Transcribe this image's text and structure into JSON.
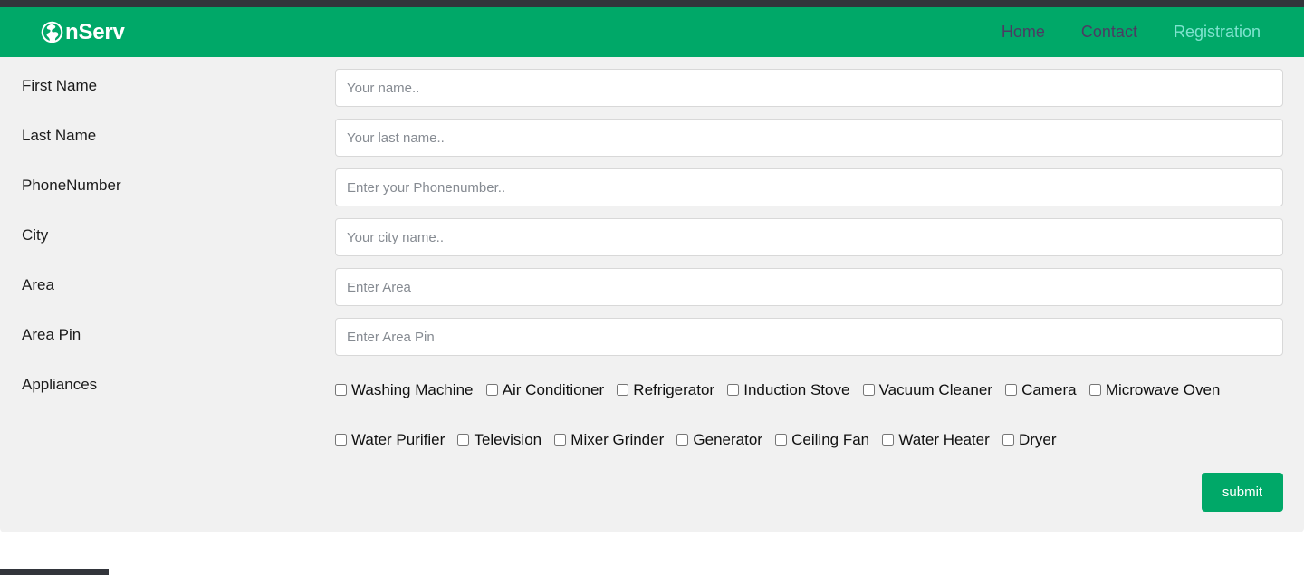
{
  "header": {
    "brand_name": "nServ",
    "brand_icon": "globe-icon",
    "background_color": "#00a868",
    "nav_links": [
      {
        "label": "Home",
        "state": "visited"
      },
      {
        "label": "Contact",
        "state": "visited"
      },
      {
        "label": "Registration",
        "state": "active"
      }
    ]
  },
  "form": {
    "fields": [
      {
        "label": "First Name",
        "placeholder": "Your name..",
        "value": ""
      },
      {
        "label": "Last Name",
        "placeholder": "Your last name..",
        "value": ""
      },
      {
        "label": "PhoneNumber",
        "placeholder": "Enter your Phonenumber..",
        "value": ""
      },
      {
        "label": "City",
        "placeholder": "Your city name..",
        "value": ""
      },
      {
        "label": "Area",
        "placeholder": "Enter Area",
        "value": ""
      },
      {
        "label": "Area Pin",
        "placeholder": "Enter Area Pin",
        "value": ""
      }
    ],
    "appliances_label": "Appliances",
    "appliances": [
      {
        "label": "Washing Machine",
        "checked": false
      },
      {
        "label": "Air Conditioner",
        "checked": false
      },
      {
        "label": "Refrigerator",
        "checked": false
      },
      {
        "label": "Induction Stove",
        "checked": false
      },
      {
        "label": "Vacuum Cleaner",
        "checked": false
      },
      {
        "label": "Camera",
        "checked": false
      },
      {
        "label": "Microwave Oven",
        "checked": false
      },
      {
        "label": "Water Purifier",
        "checked": false
      },
      {
        "label": "Television",
        "checked": false
      },
      {
        "label": "Mixer Grinder",
        "checked": false
      },
      {
        "label": "Generator",
        "checked": false
      },
      {
        "label": "Ceiling Fan",
        "checked": false
      },
      {
        "label": "Water Heater",
        "checked": false
      },
      {
        "label": "Dryer",
        "checked": false
      }
    ],
    "submit_label": "submit",
    "submit_color": "#00a868",
    "panel_background": "#f1f1f1"
  },
  "chrome": {
    "top_strip_color": "#32353b",
    "bottom_bar_color": "#32353b"
  }
}
